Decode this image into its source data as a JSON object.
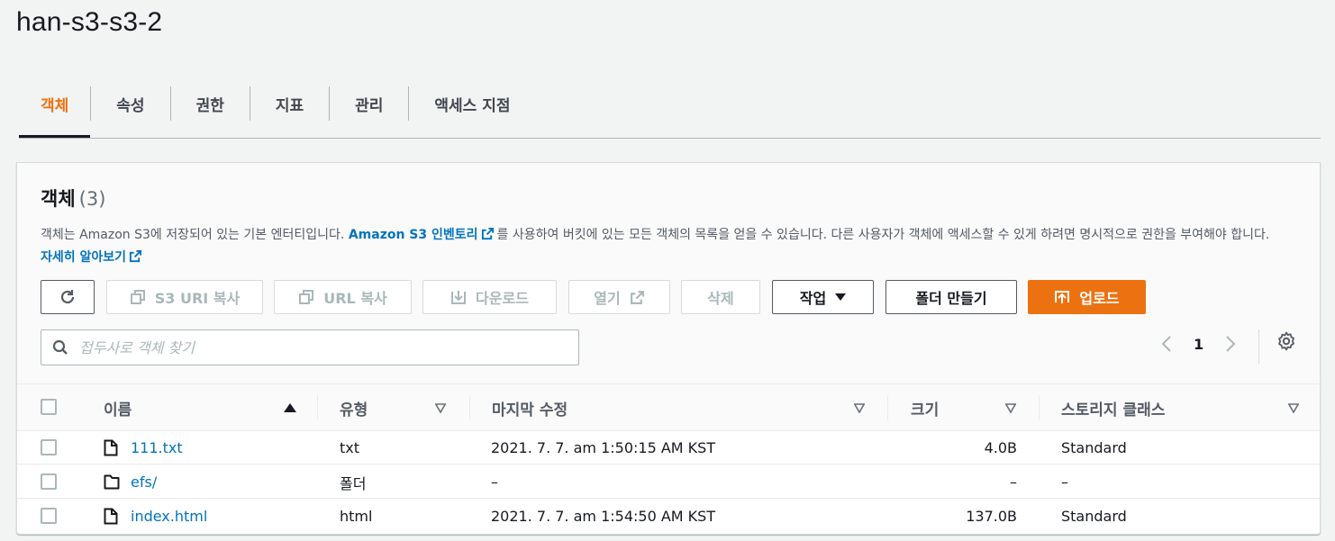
{
  "page": {
    "title": "han-s3-s3-2"
  },
  "tabs": [
    {
      "label": "객체",
      "active": true
    },
    {
      "label": "속성"
    },
    {
      "label": "권한"
    },
    {
      "label": "지표"
    },
    {
      "label": "관리"
    },
    {
      "label": "액세스 지점"
    }
  ],
  "objects": {
    "title": "객체",
    "count": "(3)",
    "description": {
      "part1": "객체는 Amazon S3에 저장되어 있는 기본 엔터티입니다. ",
      "inventory_link": "Amazon S3 인벤토리",
      "part2": "를 사용하여 버킷에 있는 모든 객체의 목록을 얻을 수 있습니다. 다른 사용자가 객체에 액세스할 수 있게 하려면 명시적으로 권한을 부여해야 합니다. ",
      "learn_more": "자세히 알아보기"
    },
    "toolbar": {
      "copy_s3_uri": "S3 URI 복사",
      "copy_url": "URL 복사",
      "download": "다운로드",
      "open": "열기",
      "delete": "삭제",
      "actions": "작업",
      "create_folder": "폴더 만들기",
      "upload": "업로드"
    },
    "search": {
      "placeholder": "접두사로 객체 찾기"
    },
    "pagination": {
      "current_page": "1"
    },
    "columns": {
      "name": "이름",
      "type": "유형",
      "last_modified": "마지막 수정",
      "size": "크기",
      "storage_class": "스토리지 클래스"
    },
    "rows": [
      {
        "name": "111.txt",
        "icon": "file-icon",
        "type": "txt",
        "last_modified": "2021. 7. 7. am 1:50:15 AM KST",
        "size": "4.0B",
        "storage_class": "Standard"
      },
      {
        "name": "efs/",
        "icon": "folder-icon",
        "type": "폴더",
        "last_modified": "–",
        "size": "–",
        "storage_class": "–"
      },
      {
        "name": "index.html",
        "icon": "file-icon",
        "type": "html",
        "last_modified": "2021. 7. 7. am 1:54:50 AM KST",
        "size": "137.0B",
        "storage_class": "Standard"
      }
    ]
  },
  "colors": {
    "accent": "#ec7211",
    "link": "#0073bb",
    "text": "#16191f",
    "muted": "#545b64",
    "disabled": "#aab7b8"
  }
}
